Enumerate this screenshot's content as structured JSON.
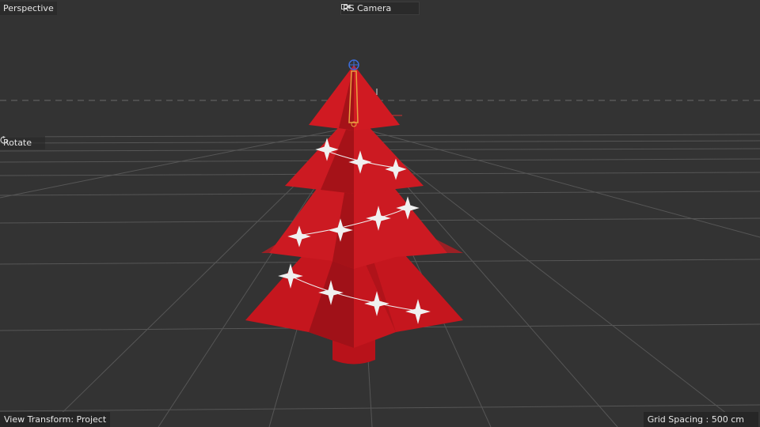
{
  "viewport": {
    "view_name": "Perspective",
    "camera_name": "RS Camera",
    "camera_icon": "camera-lock-icon",
    "tool_label": "Rotate",
    "tool_icon": "rotate-icon",
    "view_transform": "View Transform: Project",
    "grid_spacing": "Grid Spacing : 500 cm"
  },
  "colors": {
    "background": "#333333",
    "grid": "#555555",
    "tree_red": "#c0141c",
    "tree_dark": "#8a0f15",
    "stars": "#f2f2f2",
    "selection_orange": "#e8a040",
    "axis_blue": "#3c6cd8"
  }
}
